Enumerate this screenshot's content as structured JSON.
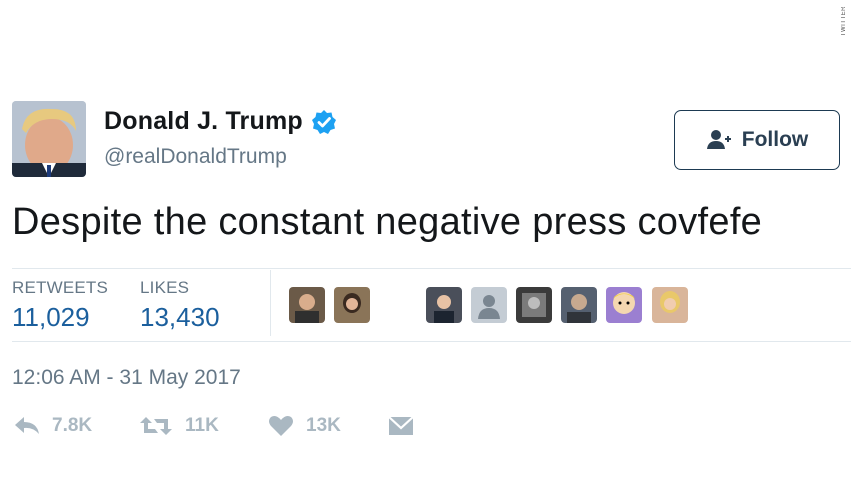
{
  "tweet": {
    "display_name": "Donald J. Trump",
    "handle": "@realDonaldTrump",
    "text": "Despite the constant negative press covfefe",
    "timestamp": "12:06 AM - 31 May 2017"
  },
  "follow_button": {
    "label": "Follow"
  },
  "stats": {
    "retweets_label": "RETWEETS",
    "retweets_value": "11,029",
    "likes_label": "LIKES",
    "likes_value": "13,430"
  },
  "actions": {
    "reply_count": "7.8K",
    "retweet_count": "11K",
    "like_count": "13K"
  },
  "watermark": "TWITTER",
  "colors": {
    "verified": "#1da1f2",
    "stat_value": "#1b5f9d",
    "muted": "#657786",
    "action_icon": "#aab8c2",
    "divider": "#e1e8ed"
  },
  "icons": [
    "verified-badge-icon",
    "add-user-icon",
    "reply-icon",
    "retweet-icon",
    "heart-icon",
    "direct-message-icon"
  ]
}
